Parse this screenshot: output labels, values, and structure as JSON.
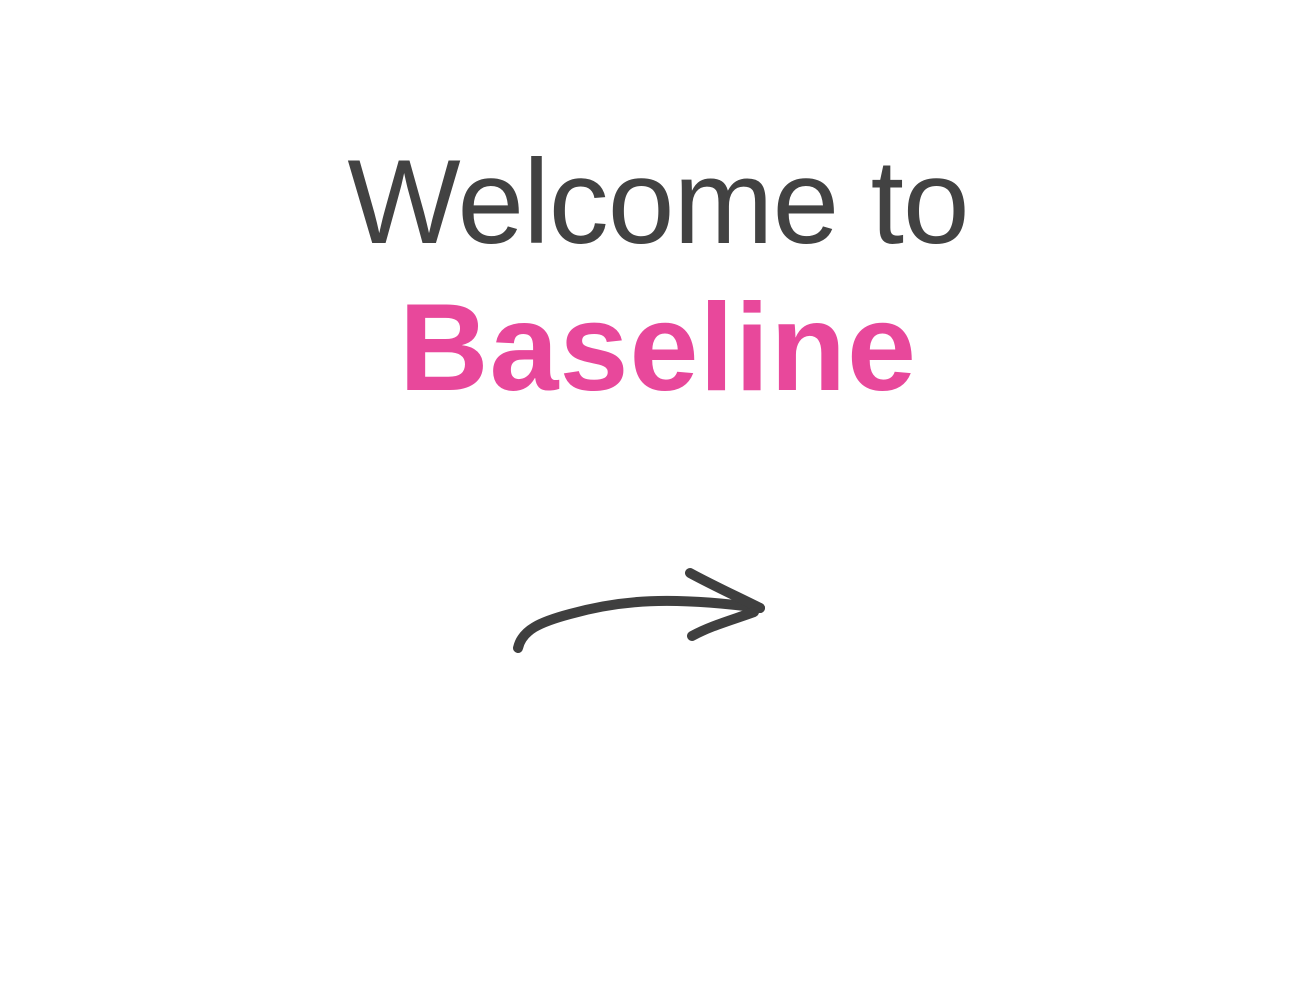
{
  "welcome": {
    "greeting": "Welcome to",
    "brand": "Baseline"
  },
  "icons": {
    "next": "curved-arrow-right-icon"
  },
  "colors": {
    "text": "#424242",
    "brand": "#e8489b",
    "arrow": "#3f3f3f",
    "background": "#ffffff"
  }
}
